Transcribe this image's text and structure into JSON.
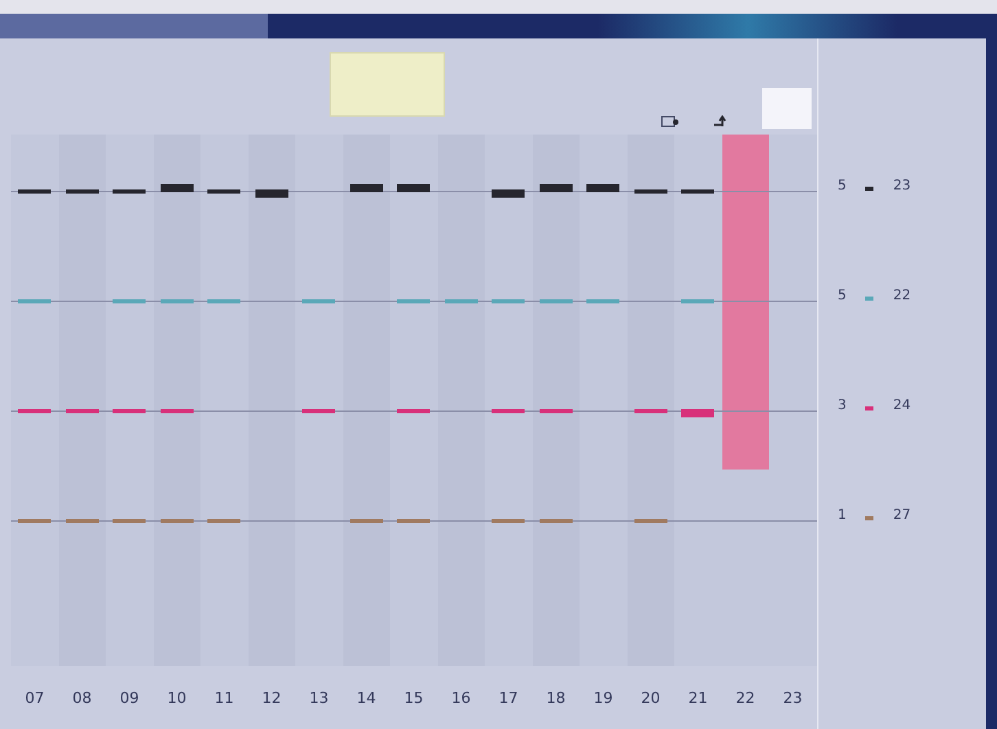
{
  "ink_rows": [
    {
      "color": "#26262e",
      "reading": "5",
      "value": "23"
    },
    {
      "color": "#5aa8b8",
      "reading": "5",
      "value": "22"
    },
    {
      "color": "#d8307a",
      "reading": "3",
      "value": "24"
    },
    {
      "color": "#a07a60",
      "reading": "1",
      "value": "27"
    }
  ],
  "zones": [
    {
      "label": "07",
      "selected": false,
      "inks": [
        {
          "kind": "flat"
        },
        {
          "kind": "flat"
        },
        {
          "kind": "flat"
        },
        {
          "kind": "flat"
        }
      ]
    },
    {
      "label": "08",
      "selected": false,
      "inks": [
        {
          "kind": "flat"
        },
        {
          "kind": "none"
        },
        {
          "kind": "flat"
        },
        {
          "kind": "flat"
        }
      ]
    },
    {
      "label": "09",
      "selected": false,
      "inks": [
        {
          "kind": "flat"
        },
        {
          "kind": "flat"
        },
        {
          "kind": "flat"
        },
        {
          "kind": "flat"
        }
      ]
    },
    {
      "label": "10",
      "selected": false,
      "inks": [
        {
          "kind": "raised"
        },
        {
          "kind": "flat"
        },
        {
          "kind": "flat"
        },
        {
          "kind": "flat"
        }
      ]
    },
    {
      "label": "11",
      "selected": false,
      "inks": [
        {
          "kind": "flat"
        },
        {
          "kind": "flat"
        },
        {
          "kind": "none"
        },
        {
          "kind": "flat"
        }
      ]
    },
    {
      "label": "12",
      "selected": false,
      "inks": [
        {
          "kind": "lowered"
        },
        {
          "kind": "none"
        },
        {
          "kind": "none"
        },
        {
          "kind": "none"
        }
      ]
    },
    {
      "label": "13",
      "selected": false,
      "inks": [
        {
          "kind": "none"
        },
        {
          "kind": "flat"
        },
        {
          "kind": "flat"
        },
        {
          "kind": "none"
        }
      ]
    },
    {
      "label": "14",
      "selected": false,
      "inks": [
        {
          "kind": "raised"
        },
        {
          "kind": "none"
        },
        {
          "kind": "none"
        },
        {
          "kind": "flat"
        }
      ]
    },
    {
      "label": "15",
      "selected": false,
      "inks": [
        {
          "kind": "raised"
        },
        {
          "kind": "flat"
        },
        {
          "kind": "flat"
        },
        {
          "kind": "flat"
        }
      ]
    },
    {
      "label": "16",
      "selected": false,
      "inks": [
        {
          "kind": "none"
        },
        {
          "kind": "flat"
        },
        {
          "kind": "none"
        },
        {
          "kind": "none"
        }
      ]
    },
    {
      "label": "17",
      "selected": false,
      "inks": [
        {
          "kind": "lowered"
        },
        {
          "kind": "flat"
        },
        {
          "kind": "flat"
        },
        {
          "kind": "flat"
        }
      ]
    },
    {
      "label": "18",
      "selected": false,
      "inks": [
        {
          "kind": "raised"
        },
        {
          "kind": "flat"
        },
        {
          "kind": "flat"
        },
        {
          "kind": "flat"
        }
      ]
    },
    {
      "label": "19",
      "selected": false,
      "inks": [
        {
          "kind": "raised"
        },
        {
          "kind": "flat"
        },
        {
          "kind": "none"
        },
        {
          "kind": "none"
        }
      ]
    },
    {
      "label": "20",
      "selected": false,
      "inks": [
        {
          "kind": "flat"
        },
        {
          "kind": "none"
        },
        {
          "kind": "flat"
        },
        {
          "kind": "flat"
        }
      ]
    },
    {
      "label": "21",
      "selected": false,
      "inks": [
        {
          "kind": "flat"
        },
        {
          "kind": "flat"
        },
        {
          "kind": "lowered"
        },
        {
          "kind": "none"
        }
      ]
    },
    {
      "label": "22",
      "selected": true,
      "inks": [
        {
          "kind": "none"
        },
        {
          "kind": "none"
        },
        {
          "kind": "none"
        },
        {
          "kind": "none"
        }
      ]
    },
    {
      "label": "23",
      "selected": false,
      "inks": [
        {
          "kind": "none"
        },
        {
          "kind": "none"
        },
        {
          "kind": "none"
        },
        {
          "kind": "none"
        }
      ]
    }
  ]
}
